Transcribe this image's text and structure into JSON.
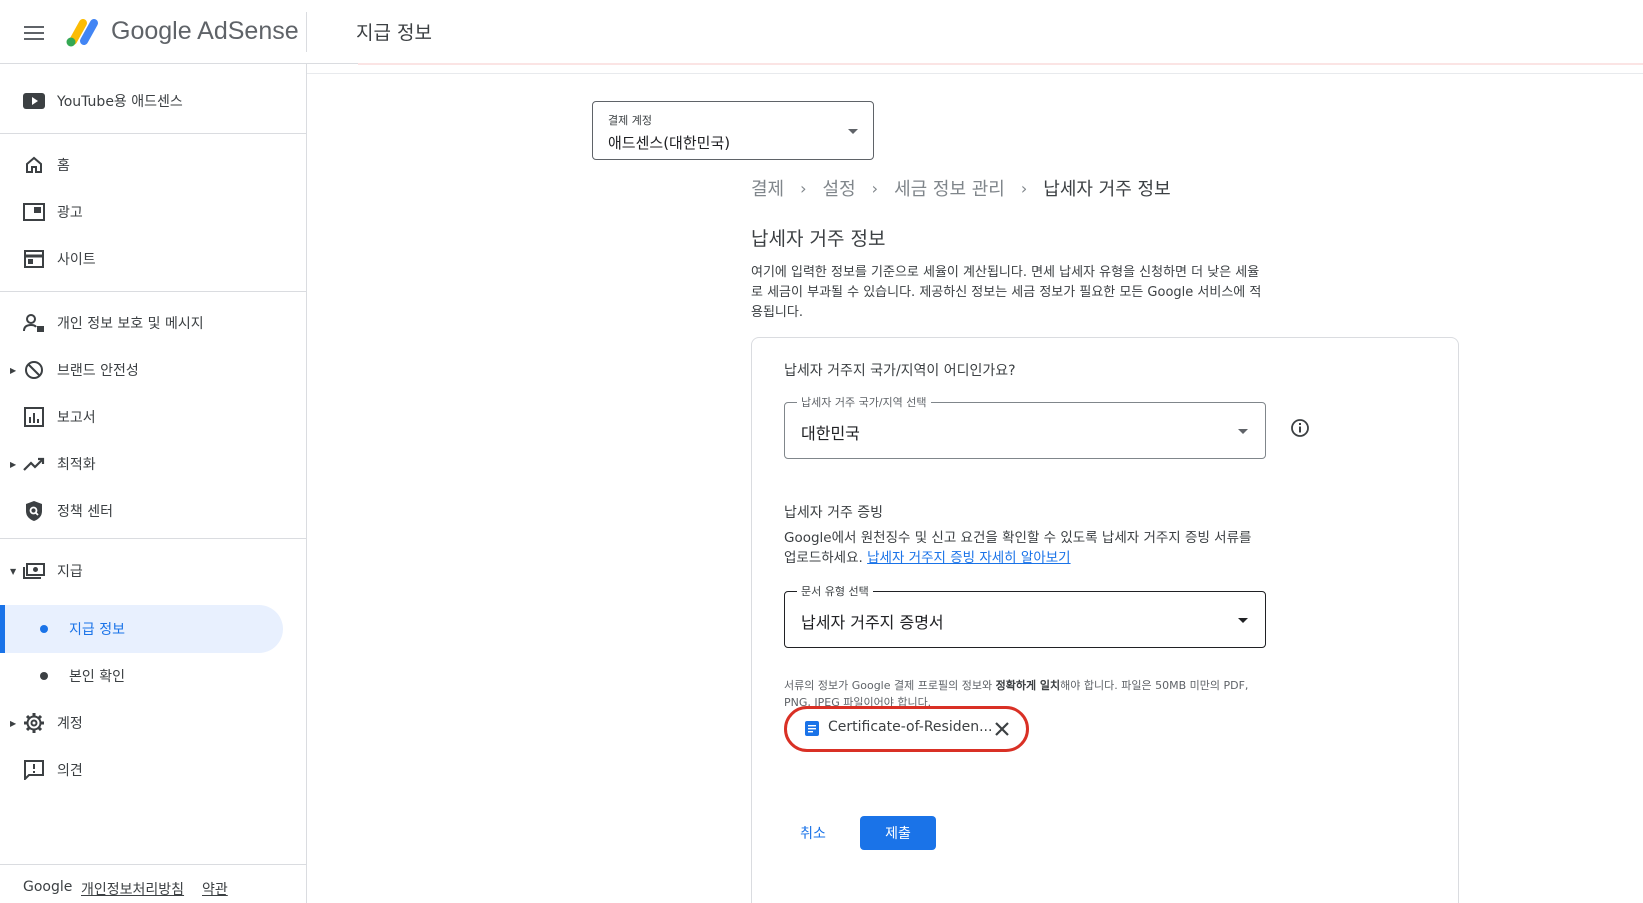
{
  "header": {
    "brand": "Google AdSense",
    "page_title": "지급 정보"
  },
  "sidebar": {
    "youtube": "YouTube용 애드센스",
    "items": [
      {
        "label": "홈",
        "icon": "home-icon"
      },
      {
        "label": "광고",
        "icon": "ads-icon"
      },
      {
        "label": "사이트",
        "icon": "sites-icon"
      },
      {
        "label": "개인 정보 보호 및 메시지",
        "icon": "privacy-messaging-icon"
      },
      {
        "label": "브랜드 안전성",
        "icon": "brand-safety-icon"
      },
      {
        "label": "보고서",
        "icon": "reports-icon"
      },
      {
        "label": "최적화",
        "icon": "optimization-icon"
      },
      {
        "label": "정책 센터",
        "icon": "policy-center-icon"
      },
      {
        "label": "지급",
        "icon": "payments-icon"
      },
      {
        "label": "계정",
        "icon": "account-gear-icon"
      },
      {
        "label": "의견",
        "icon": "feedback-icon"
      }
    ],
    "sub_items": [
      {
        "label": "지급 정보",
        "active": true
      },
      {
        "label": "본인 확인",
        "active": false
      }
    ],
    "footer": {
      "google": "Google",
      "privacy": "개인정보처리방침",
      "terms": "약관"
    }
  },
  "account_selector": {
    "label": "결제 계정",
    "value": "애드센스(대한민국)"
  },
  "breadcrumb": [
    "결제",
    "설정",
    "세금 정보 관리",
    "납세자 거주 정보"
  ],
  "section": {
    "title": "납세자 거주 정보",
    "description": "여기에 입력한 정보를 기준으로 세율이 계산됩니다. 면세 납세자 유형을 신청하면 더 낮은 세율로 세금이 부과될 수 있습니다. 제공하신 정보는 세금 정보가 필요한 모든 Google 서비스에 적용됩니다."
  },
  "form": {
    "question": "납세자 거주지 국가/지역이 어디인가요?",
    "country_field": {
      "label": "납세자 거주 국가/지역 선택",
      "value": "대한민국"
    },
    "proof": {
      "title": "납세자 거주 증빙",
      "description": "Google에서 원천징수 및 신고 요건을 확인할 수 있도록 납세자 거주지 증빙 서류를 업로드하세요.",
      "link": "납세자 거주지 증빙 자세히 알아보기"
    },
    "doc_type_field": {
      "label": "문서 유형 선택",
      "value": "납세자 거주지 증명서"
    },
    "note": {
      "pre": "서류의 정보가 Google 결제 프로필의 정보와 ",
      "bold": "정확하게 일치",
      "post": "해야 합니다. 파일은 50MB 미만의 PDF, PNG, JPEG 파일이어야 합니다."
    },
    "file": {
      "name": "Certificate-of-Residen..."
    },
    "buttons": {
      "cancel": "취소",
      "submit": "제출"
    }
  },
  "colors": {
    "accent": "#1a73e8",
    "active_bg": "#e8f0fe",
    "highlight": "#d93025"
  }
}
